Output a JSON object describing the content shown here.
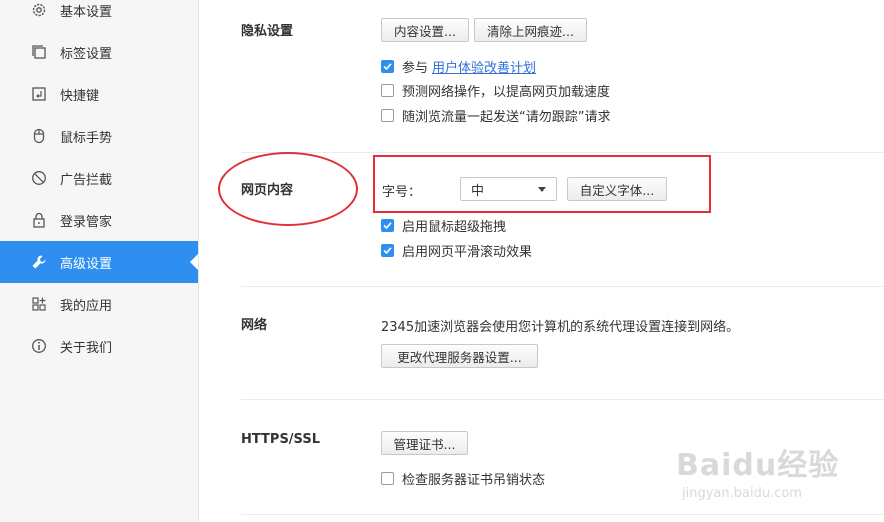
{
  "sidebar": {
    "items": [
      {
        "label": "基本设置",
        "icon": "gear-icon"
      },
      {
        "label": "标签设置",
        "icon": "tabs-icon"
      },
      {
        "label": "快捷键",
        "icon": "shortcut-key-icon"
      },
      {
        "label": "鼠标手势",
        "icon": "mouse-icon"
      },
      {
        "label": "广告拦截",
        "icon": "block-icon"
      },
      {
        "label": "登录管家",
        "icon": "lock-icon"
      },
      {
        "label": "高级设置",
        "icon": "wrench-icon",
        "active": true
      },
      {
        "label": "我的应用",
        "icon": "apps-grid-icon"
      },
      {
        "label": "关于我们",
        "icon": "info-icon"
      }
    ]
  },
  "privacy": {
    "title": "隐私设置",
    "content_settings_button": "内容设置...",
    "clear_traces_button": "清除上网痕迹...",
    "join_prefix": "参与",
    "join_link": "用户体验改善计划",
    "join_checked": true,
    "predict_label": "预测网络操作，以提高网页加载速度",
    "predict_checked": false,
    "dnt_label": "随浏览流量一起发送“请勿跟踪”请求",
    "dnt_checked": false
  },
  "web_content": {
    "title": "网页内容",
    "font_size_label": "字号：",
    "font_size_value": "中",
    "custom_fonts_button": "自定义字体...",
    "super_drag_label": "启用鼠标超级拖拽",
    "super_drag_checked": true,
    "smooth_scroll_label": "启用网页平滑滚动效果",
    "smooth_scroll_checked": true
  },
  "network": {
    "title": "网络",
    "description": "2345加速浏览器会使用您计算机的系统代理设置连接到网络。",
    "proxy_button": "更改代理服务器设置..."
  },
  "https": {
    "title": "HTTPS/SSL",
    "manage_certs_button": "管理证书...",
    "revocation_label": "检查服务器证书吊销状态",
    "revocation_checked": false
  },
  "watermark": {
    "logo_text": "Baidu经验",
    "url_text": "jingyan.baidu.com"
  },
  "colors": {
    "accent": "#2f8ff0",
    "annotation": "#e02f3a",
    "link": "#2f6fd8"
  }
}
